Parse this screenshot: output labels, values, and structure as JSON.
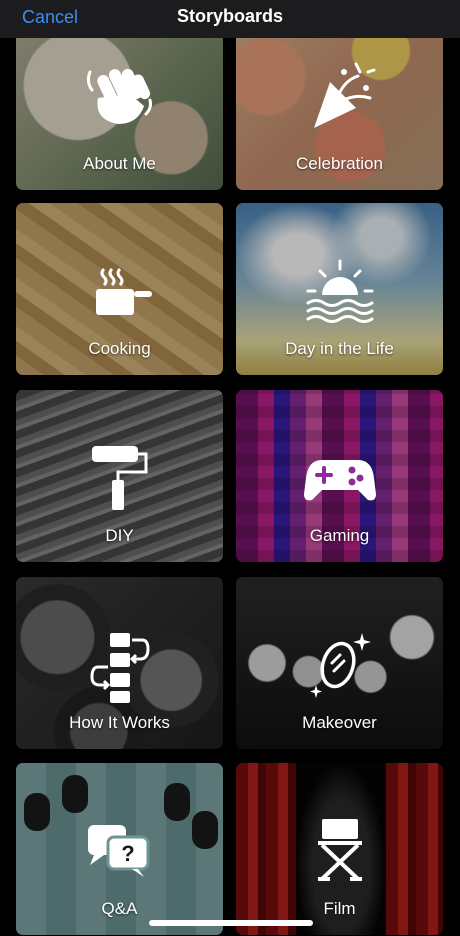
{
  "nav": {
    "cancel_label": "Cancel",
    "title": "Storyboards"
  },
  "tiles": [
    {
      "label": "About Me",
      "icon": "hand-wave-icon"
    },
    {
      "label": "Celebration",
      "icon": "party-popper-icon"
    },
    {
      "label": "Cooking",
      "icon": "cooking-pot-icon"
    },
    {
      "label": "Day in the Life",
      "icon": "sunrise-icon"
    },
    {
      "label": "DIY",
      "icon": "paint-roller-icon"
    },
    {
      "label": "Gaming",
      "icon": "game-controller-icon"
    },
    {
      "label": "How It Works",
      "icon": "flowchart-icon"
    },
    {
      "label": "Makeover",
      "icon": "mirror-sparkle-icon"
    },
    {
      "label": "Q&A",
      "icon": "speech-bubbles-question-icon"
    },
    {
      "label": "Film",
      "icon": "directors-chair-icon"
    }
  ]
}
